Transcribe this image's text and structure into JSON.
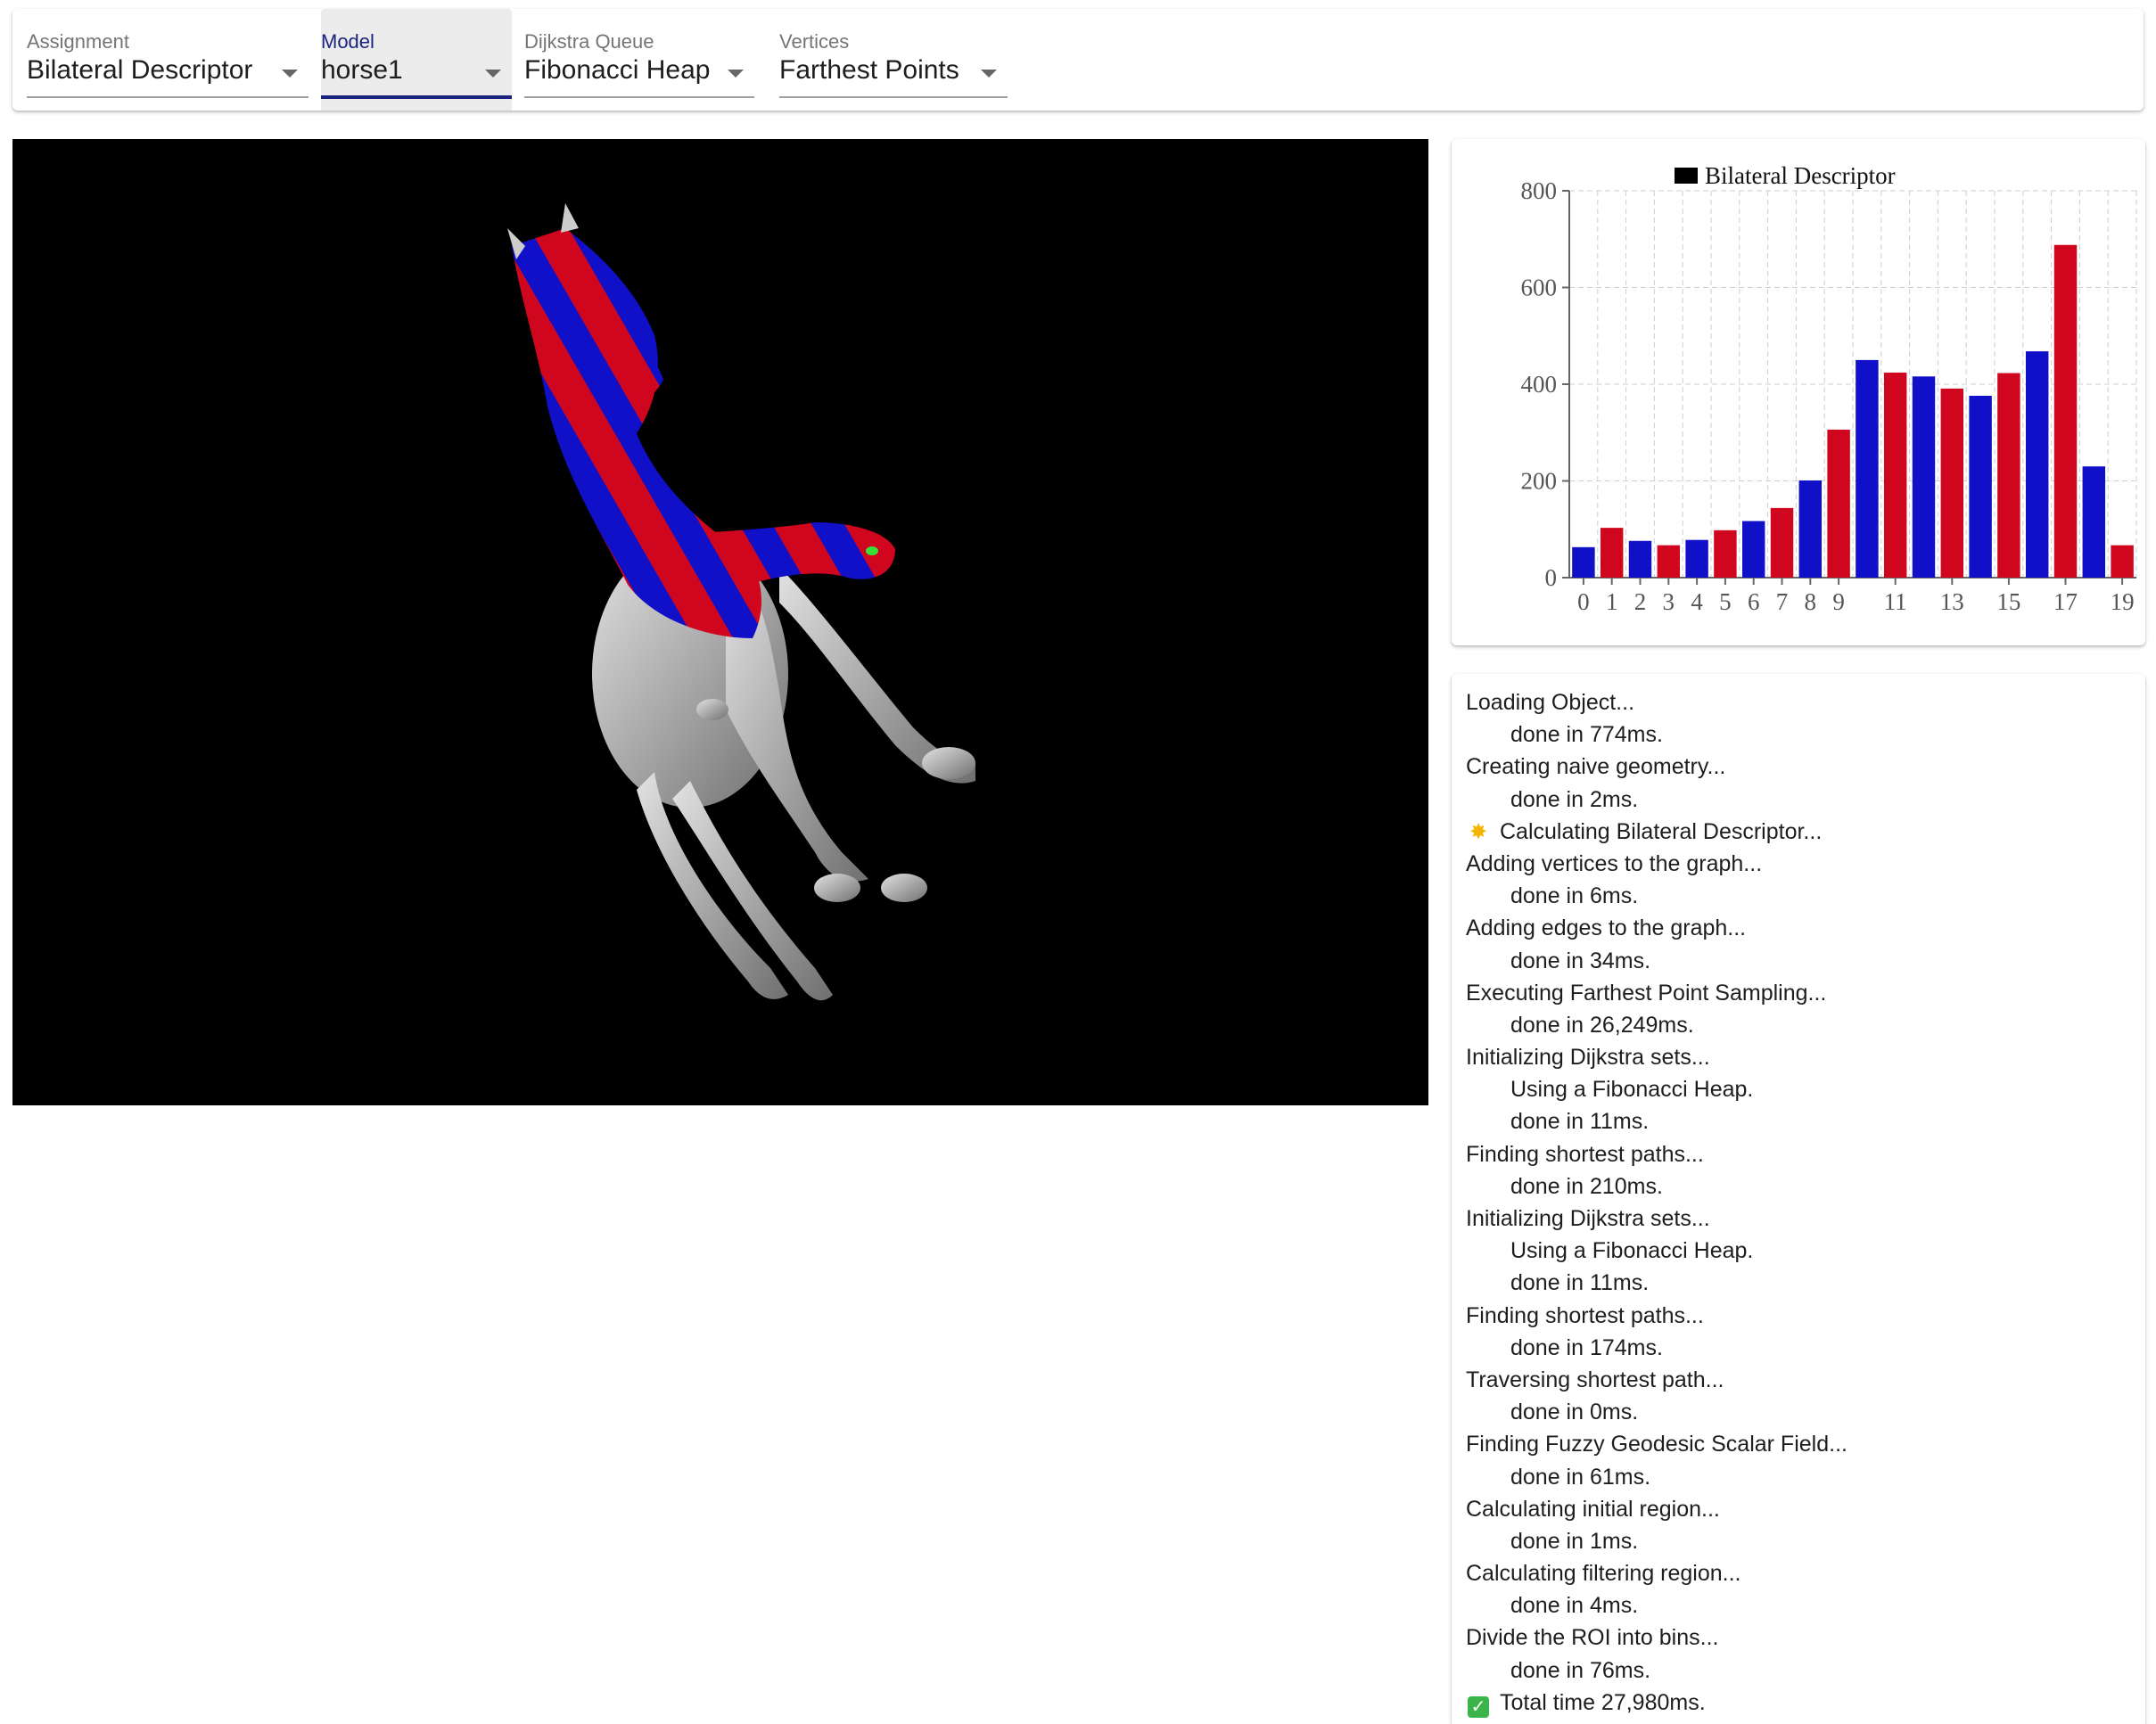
{
  "toolbar": {
    "assignment": {
      "label": "Assignment",
      "value": "Bilateral Descriptor"
    },
    "model": {
      "label": "Model",
      "value": "horse1"
    },
    "queue": {
      "label": "Dijkstra Queue",
      "value": "Fibonacci Heap"
    },
    "vertices": {
      "label": "Vertices",
      "value": "Farthest Points"
    }
  },
  "colors": {
    "blue": "#1010c8",
    "red": "#d0061f",
    "active_field": "#1a237e",
    "viewport_bg": "#000000"
  },
  "chart_data": {
    "type": "bar",
    "legend": "Bilateral Descriptor",
    "categories": [
      "0",
      "1",
      "2",
      "3",
      "4",
      "5",
      "6",
      "7",
      "8",
      "9",
      "10",
      "11",
      "12",
      "13",
      "14",
      "15",
      "16",
      "17",
      "18",
      "19"
    ],
    "x_tick_labels": [
      "0",
      "1",
      "2",
      "3",
      "4",
      "5",
      "6",
      "7",
      "8",
      "9",
      "11",
      "13",
      "15",
      "17",
      "19"
    ],
    "values": [
      63,
      103,
      76,
      67,
      78,
      98,
      117,
      144,
      201,
      306,
      450,
      424,
      416,
      391,
      376,
      423,
      468,
      688,
      230,
      67
    ],
    "bar_colors": [
      "blue",
      "red",
      "blue",
      "red",
      "blue",
      "red",
      "blue",
      "red",
      "blue",
      "red",
      "blue",
      "red",
      "blue",
      "red",
      "blue",
      "red",
      "blue",
      "red",
      "blue",
      "red"
    ],
    "ylim": [
      0,
      800
    ],
    "y_ticks": [
      0,
      200,
      400,
      600,
      800
    ],
    "grid": true,
    "legend_position": "top"
  },
  "log": {
    "lines": [
      {
        "text": "Loading Object...",
        "indent": false
      },
      {
        "text": "done in 774ms.",
        "indent": true
      },
      {
        "text": "Creating naive geometry...",
        "indent": false
      },
      {
        "text": "done in 2ms.",
        "indent": true
      },
      {
        "text": "Calculating Bilateral Descriptor...",
        "indent": false,
        "icon": "sparkle-icon"
      },
      {
        "text": "Adding vertices to the graph...",
        "indent": false
      },
      {
        "text": "done in 6ms.",
        "indent": true
      },
      {
        "text": "Adding edges to the graph...",
        "indent": false
      },
      {
        "text": "done in 34ms.",
        "indent": true
      },
      {
        "text": "Executing Farthest Point Sampling...",
        "indent": false
      },
      {
        "text": "done in 26,249ms.",
        "indent": true
      },
      {
        "text": "Initializing Dijkstra sets...",
        "indent": false
      },
      {
        "text": "Using a Fibonacci Heap.",
        "indent": true
      },
      {
        "text": "done in 11ms.",
        "indent": true
      },
      {
        "text": "Finding shortest paths...",
        "indent": false
      },
      {
        "text": "done in 210ms.",
        "indent": true
      },
      {
        "text": "Initializing Dijkstra sets...",
        "indent": false
      },
      {
        "text": "Using a Fibonacci Heap.",
        "indent": true
      },
      {
        "text": "done in 11ms.",
        "indent": true
      },
      {
        "text": "Finding shortest paths...",
        "indent": false
      },
      {
        "text": "done in 174ms.",
        "indent": true
      },
      {
        "text": "Traversing shortest path...",
        "indent": false
      },
      {
        "text": "done in 0ms.",
        "indent": true
      },
      {
        "text": "Finding Fuzzy Geodesic Scalar Field...",
        "indent": false
      },
      {
        "text": "done in 61ms.",
        "indent": true
      },
      {
        "text": "Calculating initial region...",
        "indent": false
      },
      {
        "text": "done in 1ms.",
        "indent": true
      },
      {
        "text": "Calculating filtering region...",
        "indent": false
      },
      {
        "text": "done in 4ms.",
        "indent": true
      },
      {
        "text": "Divide the ROI into bins...",
        "indent": false
      },
      {
        "text": "done in 76ms.",
        "indent": true
      },
      {
        "text": "Total time 27,980ms.",
        "indent": false,
        "icon": "check-icon"
      }
    ]
  }
}
